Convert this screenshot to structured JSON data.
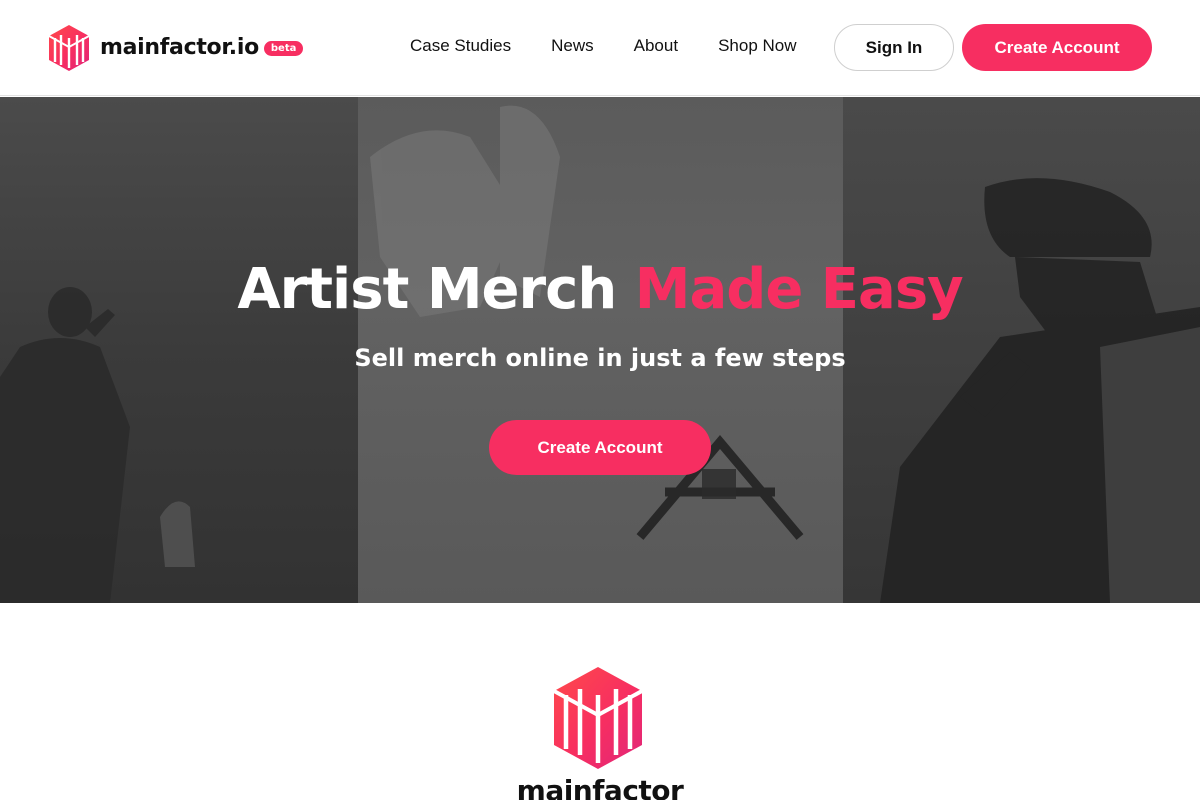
{
  "brand": {
    "name": "mainfactor.io",
    "badge": "beta",
    "accent_color": "#f72e61",
    "logo_icon": "mainfactor-cube-logo-icon"
  },
  "nav": {
    "links": [
      "Case Studies",
      "News",
      "About",
      "Shop Now"
    ]
  },
  "header": {
    "signin_label": "Sign In",
    "create_label": "Create Account"
  },
  "hero": {
    "title_main": "Artist Merch",
    "title_accent": "Made Easy",
    "subtitle": "Sell merch online in just a few steps",
    "cta_label": "Create Account"
  },
  "footer": {
    "wordmark": "mainfactor",
    "logo_icon": "mainfactor-cube-logo-icon"
  }
}
